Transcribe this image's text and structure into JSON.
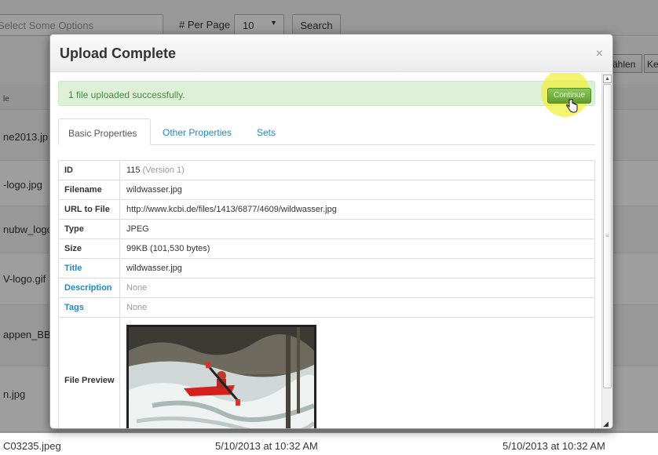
{
  "background": {
    "select_placeholder": "Select Some Options",
    "per_page_label": "# Per Page",
    "per_page_value": "10",
    "search_button": "Search",
    "btn_waehlen": "ählen",
    "btn_ke": "Ke",
    "column_header": "le",
    "rows": [
      "ne2013.jp",
      "-logo.jpg",
      "nubw_logo",
      "V-logo.gif",
      "appen_BB",
      "n.jpg"
    ],
    "last_row": {
      "filename": "C03235.jpeg",
      "created": "5/10/2013 at 10:32 AM",
      "modified": "5/10/2013 at 10:32 AM"
    }
  },
  "modal": {
    "title": "Upload Complete",
    "close": "×",
    "alert_text": "1 file uploaded successfully.",
    "continue_button": "Continue",
    "tabs": [
      "Basic Properties",
      "Other Properties",
      "Sets"
    ],
    "properties": {
      "id_label": "ID",
      "id_value": "115",
      "id_version": "(Version 1)",
      "filename_label": "Filename",
      "filename_value": "wildwasser.jpg",
      "url_label": "URL to File",
      "url_value": "http://www.kcbi.de/files/1413/6877/4609/wildwasser.jpg",
      "type_label": "Type",
      "type_value": "JPEG",
      "size_label": "Size",
      "size_value": "99KB (101,530 bytes)",
      "title_label": "Title",
      "title_value": "wildwasser.jpg",
      "description_label": "Description",
      "description_value": "None",
      "tags_label": "Tags",
      "tags_value": "None",
      "preview_label": "File Preview"
    }
  },
  "colors": {
    "link": "#1c8ac7",
    "success_bg": "#dff0d8",
    "success_text": "#468847",
    "continue_btn": "#6aa83a",
    "highlight": "#f0f032"
  }
}
